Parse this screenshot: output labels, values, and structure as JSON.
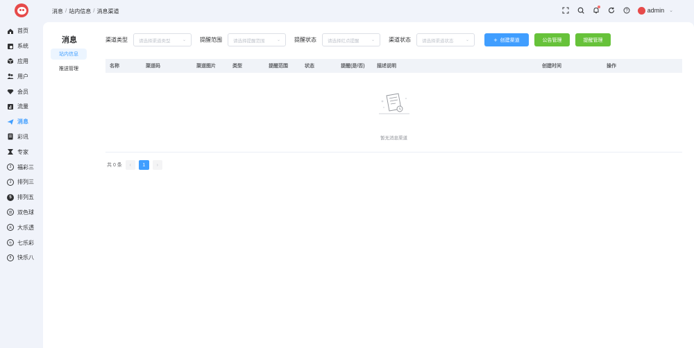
{
  "sidebar": {
    "items": [
      {
        "label": "首页",
        "icon": "home-icon"
      },
      {
        "label": "系统",
        "icon": "system-icon"
      },
      {
        "label": "应用",
        "icon": "cube-icon"
      },
      {
        "label": "用户",
        "icon": "users-icon"
      },
      {
        "label": "会员",
        "icon": "diamond-icon"
      },
      {
        "label": "流量",
        "icon": "traffic-icon"
      },
      {
        "label": "消息",
        "icon": "send-icon",
        "active": true
      },
      {
        "label": "彩讯",
        "icon": "news-icon"
      },
      {
        "label": "专家",
        "icon": "expert-icon"
      },
      {
        "label": "福彩三",
        "icon": "lottery-icon",
        "glyph": "3"
      },
      {
        "label": "排列三",
        "icon": "lottery-icon",
        "glyph": "3"
      },
      {
        "label": "排列五",
        "icon": "lottery-icon",
        "glyph": "5"
      },
      {
        "label": "双色球",
        "icon": "lottery-icon",
        "glyph": "双"
      },
      {
        "label": "大乐透",
        "icon": "lottery-icon",
        "glyph": "大"
      },
      {
        "label": "七乐彩",
        "icon": "lottery-icon",
        "glyph": "七"
      },
      {
        "label": "快乐八",
        "icon": "lottery-icon",
        "glyph": "8"
      }
    ]
  },
  "header": {
    "breadcrumb": [
      "消息",
      "站内信息",
      "消息渠道"
    ],
    "user": "admin"
  },
  "submenu": {
    "title": "消息",
    "items": [
      "站内信息",
      "推送管理"
    ]
  },
  "filters": {
    "channel_type_label": "渠道类型",
    "channel_type_placeholder": "请选择渠道类型",
    "reminder_scope_label": "提醒范围",
    "reminder_scope_placeholder": "请选择提醒范围",
    "reminder_status_label": "提醒状态",
    "reminder_status_placeholder": "请选择红点提醒",
    "channel_status_label": "渠道状态",
    "channel_status_placeholder": "请选择渠道状态",
    "create_button": "创建渠道",
    "announcement_button": "公告管理",
    "reminder_button": "提醒管理"
  },
  "table": {
    "columns": [
      "名称",
      "渠道码",
      "渠道图片",
      "类型",
      "提醒范围",
      "状态",
      "提醒(是/否)",
      "描述说明",
      "创建时间",
      "操作"
    ],
    "empty_text": "暂无消息渠道"
  },
  "pagination": {
    "total_text": "共 0 条",
    "current_page": "1"
  },
  "colors": {
    "primary": "#409eff",
    "success": "#67c23a",
    "brand": "#e64a4a"
  }
}
